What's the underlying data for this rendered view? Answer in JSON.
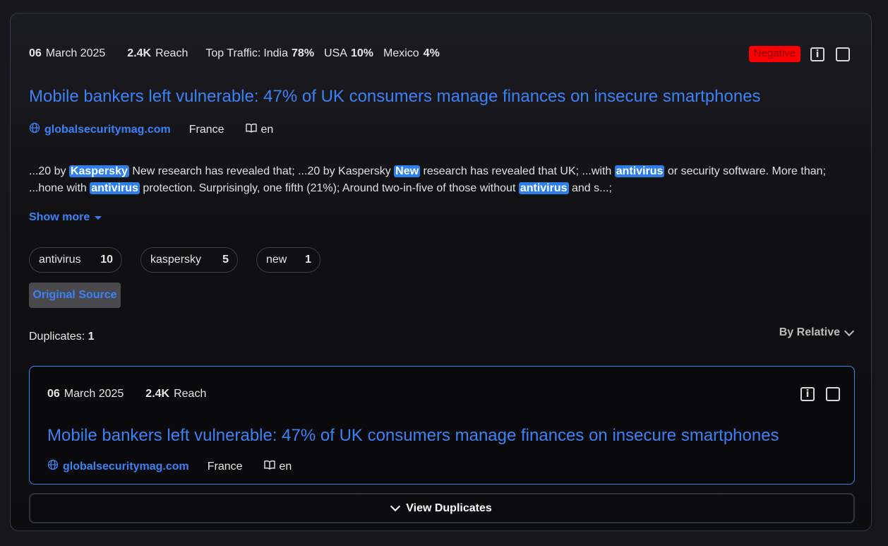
{
  "article": {
    "date_day": "06",
    "date_rest": "March 2025",
    "reach_value": "2.4K",
    "reach_label": "Reach",
    "traffic_label": "Top Traffic:",
    "traffic": [
      {
        "country": "India",
        "pct": "78%"
      },
      {
        "country": "USA",
        "pct": "10%"
      },
      {
        "country": "Mexico",
        "pct": "4%"
      }
    ],
    "sentiment": "Negative",
    "info_glyph": "i",
    "title": "Mobile bankers left vulnerable: 47% of UK consumers manage finances on insecure smartphones",
    "domain": "globalsecuritymag.com",
    "country": "France",
    "language": "en",
    "snippet": {
      "p1": "...20 by ",
      "h1": "Kaspersky",
      "p2": " New research has revealed that; ...20 by Kaspersky ",
      "h2": "New",
      "p3": " research has revealed that UK; ...with ",
      "h3": "antivirus",
      "p4": " or security software. More than; ...hone with ",
      "h4": "antivirus",
      "p5": " protection. Surprisingly, one fifth (21%); Around two-in-five of those without ",
      "h5": "antivirus",
      "p6": " and s...;"
    },
    "show_more": "Show more",
    "keywords": [
      {
        "label": "antivirus",
        "count": "10"
      },
      {
        "label": "kaspersky",
        "count": "5"
      },
      {
        "label": "new",
        "count": "1"
      }
    ],
    "original_source": "Original Source",
    "duplicates_label": "Duplicates:",
    "duplicates_count": "1",
    "sort_label": "By Relative"
  },
  "duplicate": {
    "date_day": "06",
    "date_rest": "March 2025",
    "reach_value": "2.4K",
    "reach_label": "Reach",
    "info_glyph": "i",
    "title": "Mobile bankers left vulnerable: 47% of UK consumers manage finances on insecure smartphones",
    "domain": "globalsecuritymag.com",
    "country": "France",
    "language": "en"
  },
  "view_duplicates": "View Duplicates",
  "colors": {
    "accent": "#3b82f6",
    "negative": "#ff0000",
    "highlight": "#2d7fea",
    "border": "#2f3a4a"
  },
  "icons": [
    "globe-icon",
    "book-icon",
    "info-icon",
    "checkbox-icon",
    "caret-down-icon",
    "chevron-down-icon"
  ]
}
